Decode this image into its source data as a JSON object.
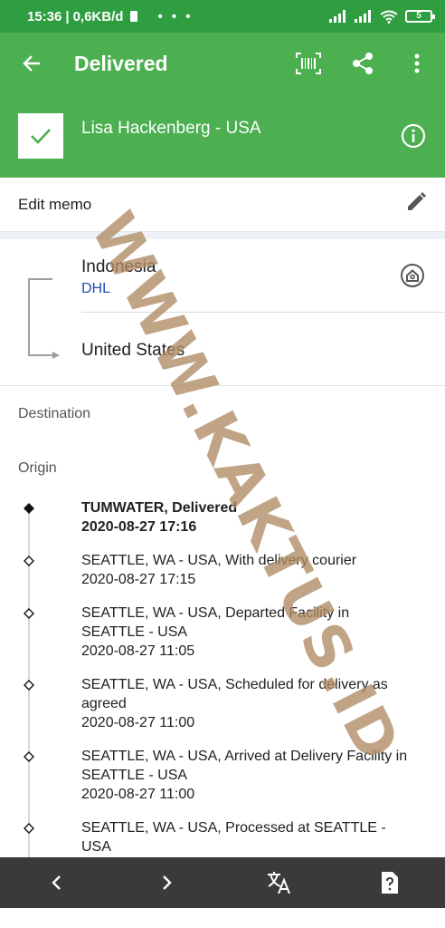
{
  "status_bar": {
    "time": "15:36",
    "net_speed": "0,6KB/d",
    "battery": "5"
  },
  "app_bar": {
    "title": "Delivered",
    "shipment_name": "Lisa Hackenberg - USA",
    "icons": [
      "back-arrow-icon",
      "barcode-icon",
      "share-icon",
      "more-vert-icon",
      "check-icon",
      "info-icon"
    ]
  },
  "memo": {
    "label": "Edit memo"
  },
  "route": {
    "origin_country": "Indonesia",
    "carrier": "DHL",
    "destination_country": "United States"
  },
  "sections": {
    "destination": "Destination",
    "origin": "Origin"
  },
  "events": [
    {
      "title": "TUMWATER, Delivered",
      "date": "2020-08-27 17:16"
    },
    {
      "title": "SEATTLE, WA - USA, With delivery courier",
      "date": "2020-08-27 17:15"
    },
    {
      "title": "SEATTLE, WA - USA, Departed Facility in SEATTLE - USA",
      "date": "2020-08-27 11:05"
    },
    {
      "title": "SEATTLE, WA - USA, Scheduled for delivery as agreed",
      "date": "2020-08-27 11:00"
    },
    {
      "title": "SEATTLE, WA - USA, Arrived at Delivery Facility in SEATTLE - USA",
      "date": "2020-08-27 11:00"
    },
    {
      "title": "SEATTLE, WA - USA, Processed at SEATTLE - USA",
      "date": ""
    }
  ],
  "watermark": "WWW.KAKTUS.ID",
  "colors": {
    "status_bar": "#2e9e41",
    "app_bar": "#4caf50",
    "carrier_link": "#1e4ea8",
    "nav_bar": "#3a3a3a",
    "watermark": "#b08a63"
  }
}
